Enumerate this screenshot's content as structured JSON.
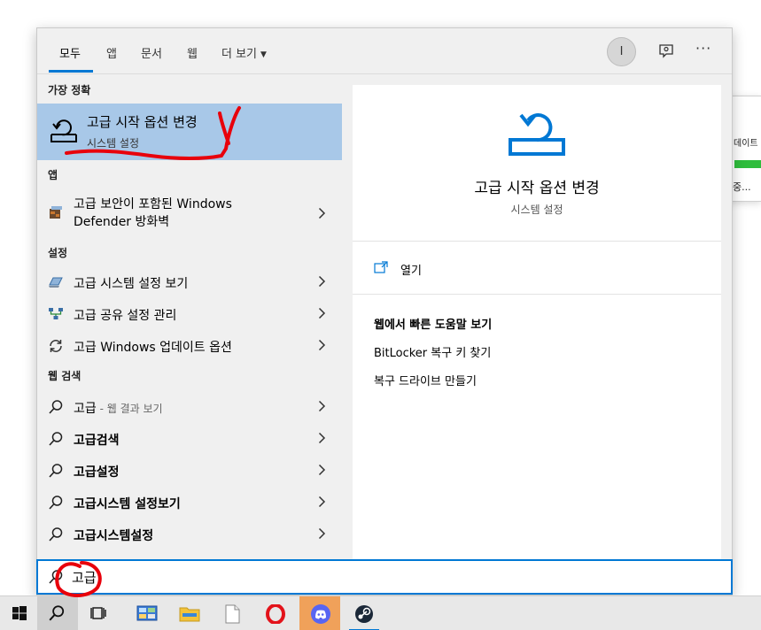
{
  "background_window": {
    "text1": "데이트",
    "text2": "중..."
  },
  "tabs": [
    {
      "label": "모두",
      "active": true
    },
    {
      "label": "앱"
    },
    {
      "label": "문서"
    },
    {
      "label": "웹"
    },
    {
      "label": "더 보기"
    }
  ],
  "user": {
    "avatar_initial": "I"
  },
  "sections": {
    "best_match": "가장 정확",
    "apps": "앱",
    "settings": "설정",
    "web": "웹 검색"
  },
  "best_match": {
    "title": "고급 시작 옵션 변경",
    "subtitle": "시스템 설정"
  },
  "apps": [
    {
      "line1": "고급 보안이 포함된 Windows",
      "line2": "Defender 방화벽"
    }
  ],
  "settings": [
    {
      "label": "고급 시스템 설정 보기"
    },
    {
      "label": "고급 공유 설정 관리"
    },
    {
      "label": "고급 Windows 업데이트 옵션"
    }
  ],
  "web": [
    {
      "label": "고급",
      "hint": " - 웹 결과 보기"
    },
    {
      "label": "고급검색"
    },
    {
      "label": "고급설정"
    },
    {
      "label": "고급시스템 설정보기"
    },
    {
      "label": "고급시스템설정"
    }
  ],
  "preview": {
    "title": "고급 시작 옵션 변경",
    "subtitle": "시스템 설정",
    "open_label": "열기",
    "help_heading": "웹에서 빠른 도움말 보기",
    "help_links": [
      "BitLocker 복구 키 찾기",
      "복구 드라이브 만들기"
    ]
  },
  "search": {
    "value": "고급"
  },
  "colors": {
    "accent": "#0078d4",
    "selection": "#a8c8e8",
    "annotation": "#e8000b"
  },
  "taskbar": [
    "windows-start",
    "search",
    "task-view",
    "control-panel",
    "file-explorer",
    "notepad",
    "opera",
    "discord",
    "steam"
  ]
}
